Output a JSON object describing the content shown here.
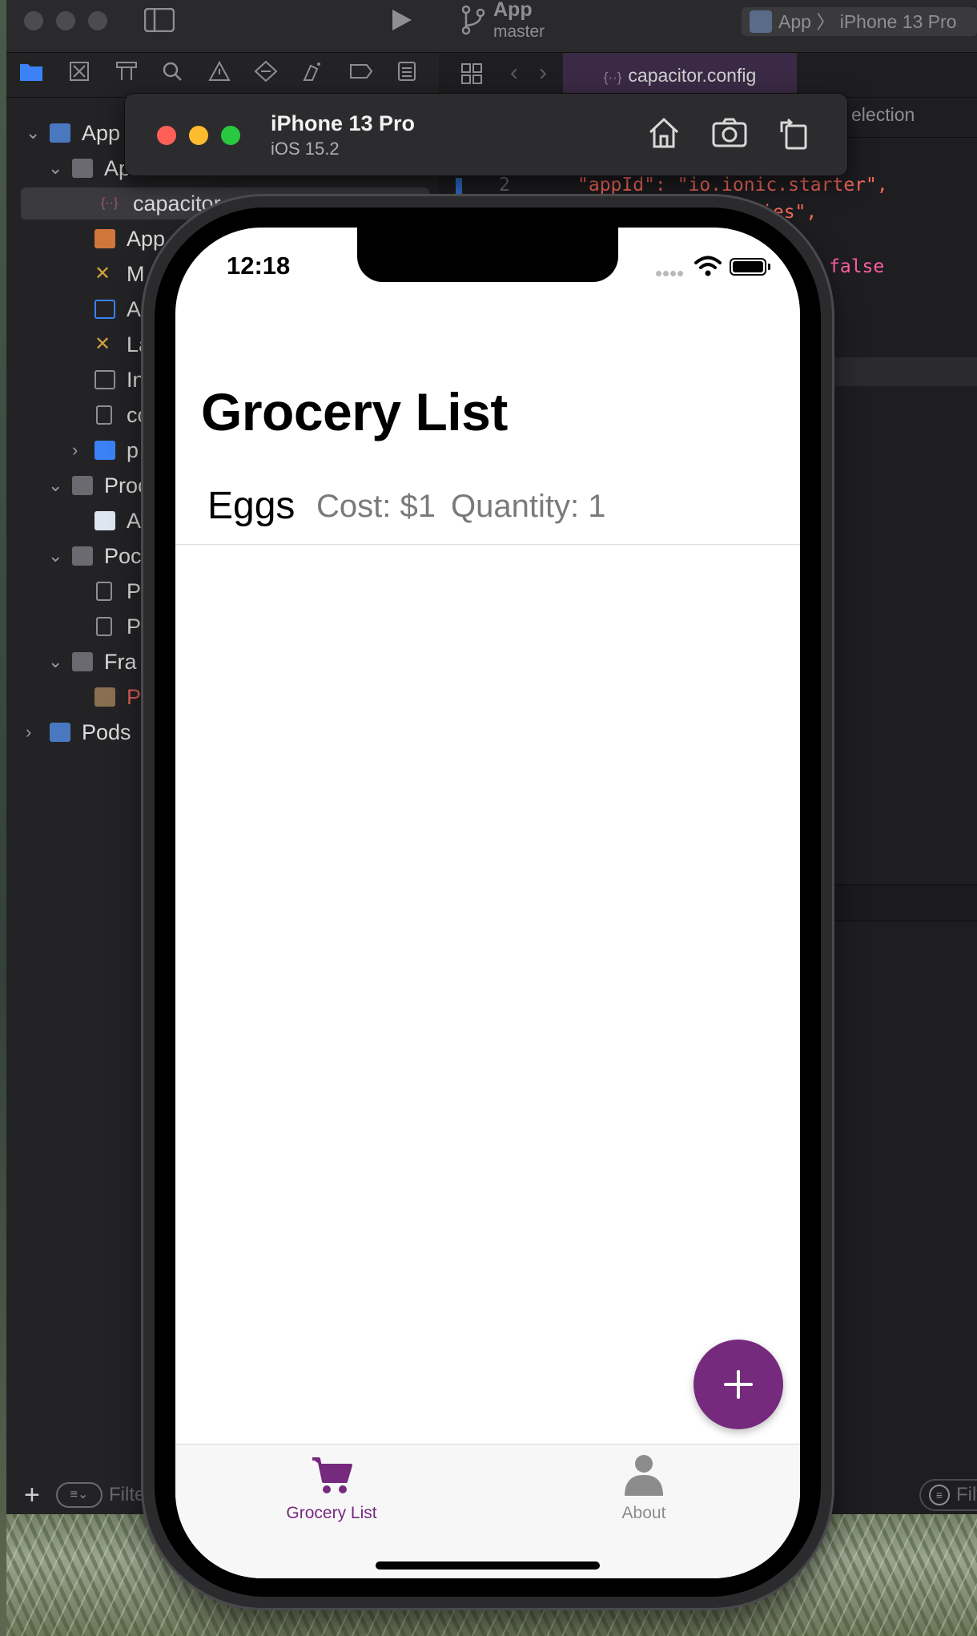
{
  "colors": {
    "accent": "#762a7e",
    "tab_inactive": "#8c8c8c",
    "secondary_text": "#7a7a7a",
    "sim_red": "#ff5f57",
    "sim_yellow": "#febc2e",
    "sim_green": "#28c840"
  },
  "xcode": {
    "scheme_title": "App",
    "scheme_branch": "master",
    "breadcrumb": "App 〉 iPhone 13 Pro",
    "editor_tab": "capacitor.config",
    "jumpbar_text": "election",
    "code": {
      "line2_number": "2",
      "line2_text": "\"appId\": \"io.ionic.starter\",",
      "line3_text": "ies\",",
      "line4_text": "false"
    },
    "navigator": [
      {
        "label": "App"
      },
      {
        "label": "Ap"
      },
      {
        "label": "capacitor"
      },
      {
        "label": "App"
      },
      {
        "label": "M"
      },
      {
        "label": "A"
      },
      {
        "label": "La"
      },
      {
        "label": "In"
      },
      {
        "label": "co"
      },
      {
        "label": "p"
      },
      {
        "label": "Proc"
      },
      {
        "label": "A"
      },
      {
        "label": "Poc"
      },
      {
        "label": "P"
      },
      {
        "label": "P"
      },
      {
        "label": "Fra"
      },
      {
        "label": "P"
      },
      {
        "label": "Pods"
      }
    ],
    "filter_placeholder": "Filte",
    "filter_placeholder_right": "Filte"
  },
  "simulator": {
    "device_name": "iPhone 13 Pro",
    "os_version": "iOS 15.2"
  },
  "app": {
    "status_time": "12:18",
    "page_title": "Grocery List",
    "items": [
      {
        "name": "Eggs",
        "cost": "Cost: $1",
        "quantity": "Quantity: 1"
      }
    ],
    "fab_icon": "plus-icon",
    "tabs": [
      {
        "label": "Grocery List",
        "icon": "cart-icon",
        "active": true
      },
      {
        "label": "About",
        "icon": "person-icon",
        "active": false
      }
    ]
  }
}
